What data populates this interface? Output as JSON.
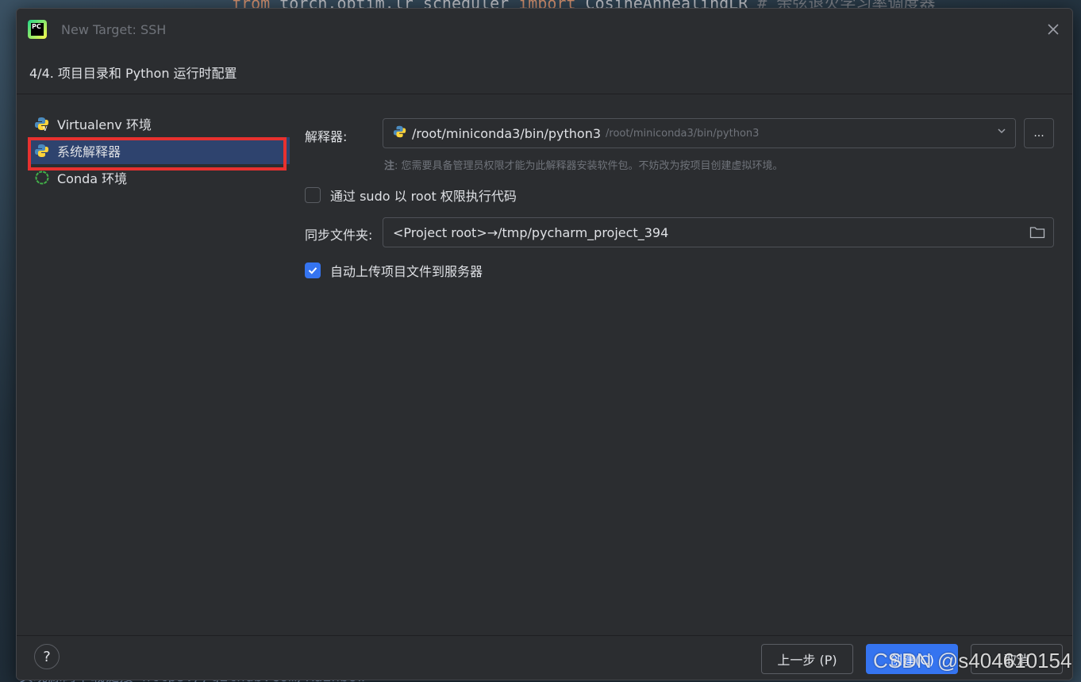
{
  "background": {
    "code_top_from": "from",
    "code_top_mid": " torch.optim.lr_scheduler ",
    "code_top_import": "import",
    "code_top_cls": " CosineAnnealingLR  ",
    "code_top_comment": "# 余弦退火学习率调度器",
    "code_bottom": "实现源码下载链接  https://github.com/Rainbow"
  },
  "window": {
    "title": "New Target: SSH",
    "app_icon_text": "PC"
  },
  "step": "4/4. 项目目录和 Python 运行时配置",
  "nav": {
    "items": [
      {
        "label": "Virtualenv 环境",
        "icon": "virtualenv-icon"
      },
      {
        "label": "系统解释器",
        "icon": "python-icon"
      },
      {
        "label": "Conda 环境",
        "icon": "conda-icon"
      }
    ],
    "selected_index": 1
  },
  "form": {
    "interpreter_label": "解释器:",
    "interpreter_value": "/root/miniconda3/bin/python3",
    "interpreter_path_hint": "/root/miniconda3/bin/python3",
    "more_button": "...",
    "note_prefix": "注",
    "note_text": ": 您需要具备管理员权限才能为此解释器安装软件包。不妨改为按项目创建虚拟环境。",
    "sudo_label": "通过 sudo 以 root 权限执行代码",
    "sudo_checked": false,
    "sync_label": "同步文件夹:",
    "sync_value": "<Project root>→/tmp/pycharm_project_394",
    "upload_label": "自动上传项目文件到服务器",
    "upload_checked": true
  },
  "footer": {
    "help": "?",
    "prev": "上一步 (P)",
    "create": "创建(C)",
    "cancel": "取消"
  },
  "watermark": "CSDN @s404610154",
  "colors": {
    "accent": "#3574f0",
    "highlight_box": "#e8312f",
    "selected_row": "#2e436e"
  }
}
